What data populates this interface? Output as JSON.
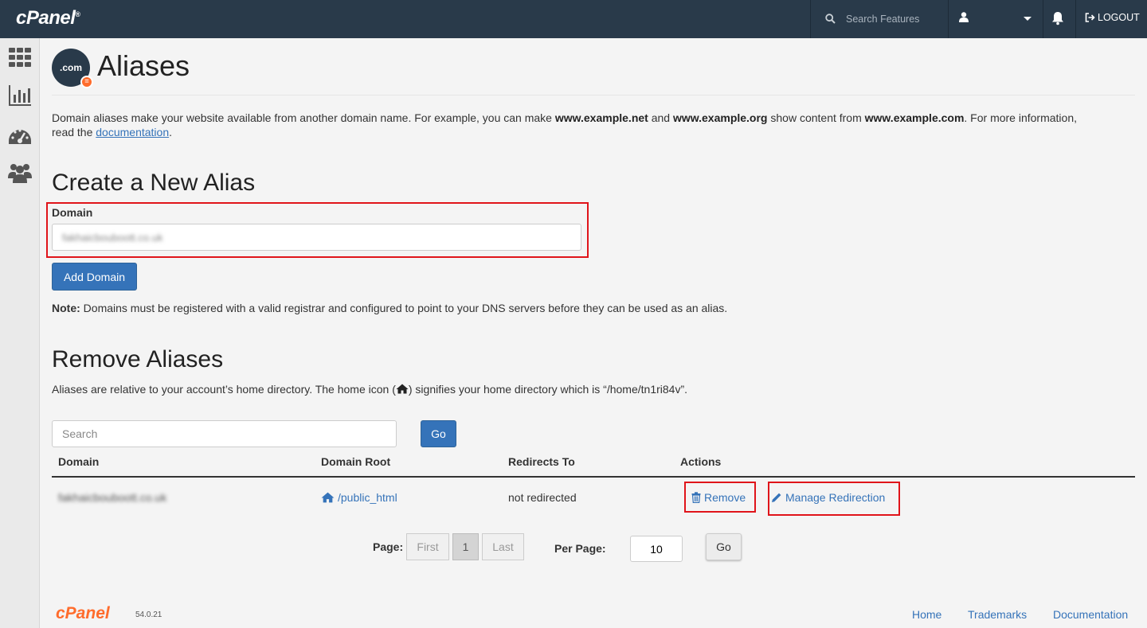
{
  "topbar": {
    "brand": "cPanel",
    "brand_mark": "®",
    "search_placeholder": "Search Features",
    "logout_label": "LOGOUT"
  },
  "sidebar": {
    "items": [
      {
        "icon": "grid-icon"
      },
      {
        "icon": "bar-chart-icon"
      },
      {
        "icon": "dashboard-icon"
      },
      {
        "icon": "users-icon"
      }
    ]
  },
  "page": {
    "icon_text": ".com",
    "title": "Aliases",
    "intro_part1": "Domain aliases make your website available from another domain name. For example, you can make ",
    "example_net": "www.example.net",
    "intro_and": " and ",
    "example_org": "www.example.org",
    "intro_part2": " show content from ",
    "example_com": "www.example.com",
    "intro_part3": ". For more information, read the ",
    "doc_link": "documentation",
    "intro_end": "."
  },
  "create": {
    "heading": "Create a New Alias",
    "domain_label": "Domain",
    "domain_value": "fakhaicbouboott.co.uk",
    "add_button": "Add Domain",
    "note_label": "Note:",
    "note_text": " Domains must be registered with a valid registrar and configured to point to your DNS servers before they can be used as an alias."
  },
  "remove": {
    "heading": "Remove Aliases",
    "desc_part1": "Aliases are relative to your account’s home directory. The home icon (",
    "desc_part2": ") signifies your home directory which is “/home/tn1ri84v”.",
    "search_placeholder": "Search",
    "go_label": "Go",
    "columns": [
      "Domain",
      "Domain Root",
      "Redirects To",
      "Actions"
    ],
    "rows": [
      {
        "domain": "fakhaicbouboott.co.uk",
        "root": "/public_html",
        "redirects": "not redirected",
        "remove_label": "Remove",
        "manage_label": "Manage Redirection"
      }
    ]
  },
  "pagination": {
    "page_label": "Page:",
    "first": "First",
    "current": "1",
    "last": "Last",
    "per_page_label": "Per Page:",
    "per_page_value": "10",
    "go_label": "Go"
  },
  "footer": {
    "logo": "cPanel",
    "version": "54.0.21",
    "links": [
      "Home",
      "Trademarks",
      "Documentation"
    ]
  },
  "colors": {
    "topbar": "#293a4a",
    "link": "#3573b9",
    "primary_button": "#3573b9",
    "highlight_box": "#e0141a",
    "brand_orange": "#ff6c2c"
  }
}
